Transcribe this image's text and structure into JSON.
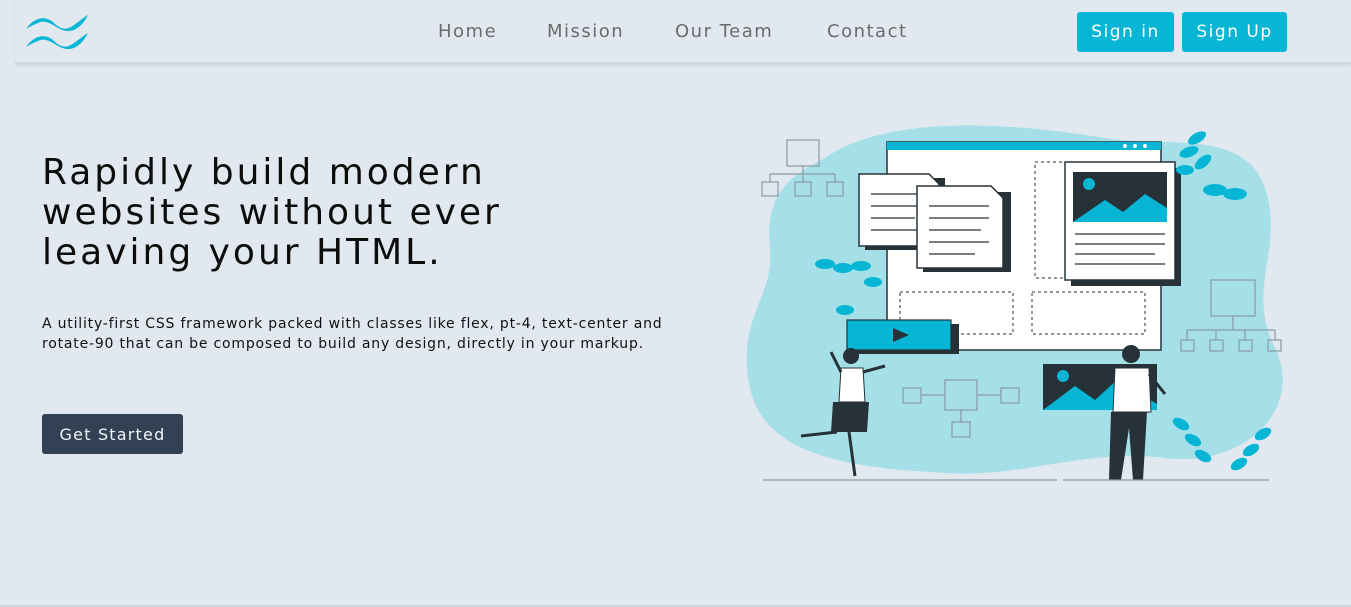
{
  "brand": {
    "logo_icon": "wind-waves-icon",
    "color": "#06b6d4"
  },
  "nav": {
    "links": [
      "Home",
      "Mission",
      "Our Team",
      "Contact"
    ],
    "sign_in": "Sign in",
    "sign_up": "Sign Up"
  },
  "hero": {
    "title": "Rapidly build modern websites without ever leaving your HTML.",
    "description": "A utility-first CSS framework packed with classes like flex, pt-4, text-center and rotate-90 that can be composed to build any design, directly in your markup.",
    "cta": "Get Started"
  },
  "colors": {
    "background": "#e2e8f0",
    "accent": "#06b6d4",
    "cta_bg": "#334155",
    "illustration_blob": "#a5e0e8",
    "illustration_dark": "#263238"
  }
}
